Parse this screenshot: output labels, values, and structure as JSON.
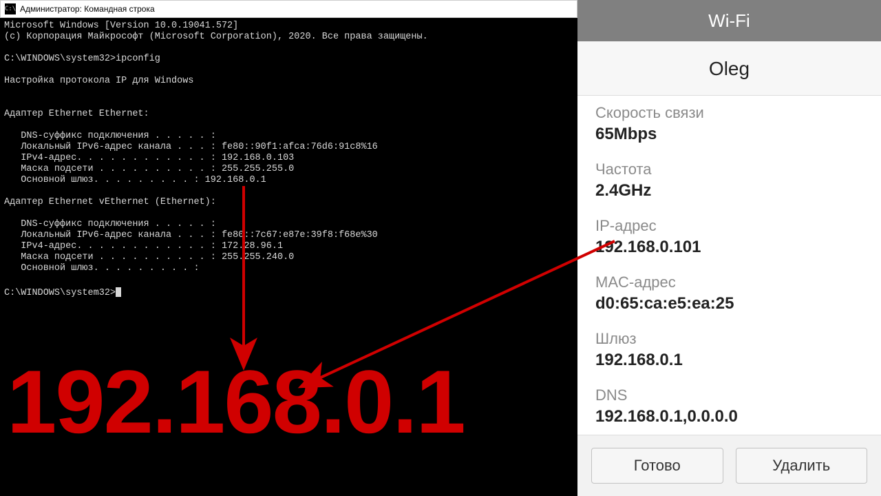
{
  "cmd": {
    "title": "Администратор: Командная строка",
    "icon_text": "C:\\",
    "body": "Microsoft Windows [Version 10.0.19041.572]\n(c) Корпорация Майкрософт (Microsoft Corporation), 2020. Все права защищены.\n\nC:\\WINDOWS\\system32>ipconfig\n\nНастройка протокола IP для Windows\n\n\nАдаптер Ethernet Ethernet:\n\n   DNS-суффикс подключения . . . . . :\n   Локальный IPv6-адрес канала . . . : fe80::90f1:afca:76d6:91c8%16\n   IPv4-адрес. . . . . . . . . . . . : 192.168.0.103\n   Маска подсети . . . . . . . . . . : 255.255.255.0\n   Основной шлюз. . . . . . . . . : 192.168.0.1\n\nАдаптер Ethernet vEthernet (Ethernet):\n\n   DNS-суффикс подключения . . . . . :\n   Локальный IPv6-адрес канала . . . : fe80::7c67:e87e:39f8:f68e%30\n   IPv4-адрес. . . . . . . . . . . . : 172.28.96.1\n   Маска подсети . . . . . . . . . . : 255.255.240.0\n   Основной шлюз. . . . . . . . . :\n\nC:\\WINDOWS\\system32>"
  },
  "big_ip": "192.168.0.1",
  "phone": {
    "header": "Wi-Fi",
    "title": "Oleg",
    "items": [
      {
        "label": "Скорость связи",
        "value": "65Mbps"
      },
      {
        "label": "Частота",
        "value": "2.4GHz"
      },
      {
        "label": "IP-адрес",
        "value": "192.168.0.101"
      },
      {
        "label": "MAC-адрес",
        "value": "d0:65:ca:e5:ea:25"
      },
      {
        "label": "Шлюз",
        "value": "192.168.0.1"
      },
      {
        "label": "DNS",
        "value": "192.168.0.1,0.0.0.0"
      }
    ],
    "buttons": {
      "done": "Готово",
      "delete": "Удалить"
    }
  },
  "arrow_color": "#d00000"
}
